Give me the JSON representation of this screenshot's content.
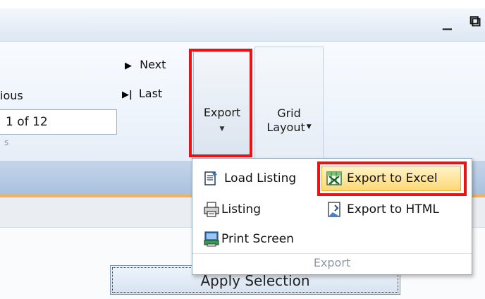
{
  "window": {
    "controls": "_ ⧉"
  },
  "ribbon": {
    "nav": {
      "next_label": "Next",
      "last_label": "Last",
      "previous_label_partial": "ious",
      "page_value": "1 of 12",
      "group_label_partial": "s"
    },
    "export_button": {
      "label": "Export"
    },
    "grid_layout_button": {
      "line1": "Grid",
      "line2": "Layout"
    }
  },
  "dropdown": {
    "items": [
      {
        "label": "Load Listing",
        "icon": "load-listing-icon"
      },
      {
        "label": "Export to Excel",
        "icon": "excel-icon",
        "highlighted": true
      },
      {
        "label": "Listing",
        "icon": "printer-listing-icon"
      },
      {
        "label": "Export to HTML",
        "icon": "html-export-icon"
      },
      {
        "label": "Print Screen",
        "icon": "print-screen-icon"
      }
    ],
    "group_label": "Export"
  },
  "apply_button": {
    "label": "Apply Selection"
  },
  "colors": {
    "highlight_red": "#ee1111",
    "hover_yellow": "#ffd877",
    "ribbon_blue": "#a9c1df",
    "accent_orange": "#f2b15a"
  }
}
